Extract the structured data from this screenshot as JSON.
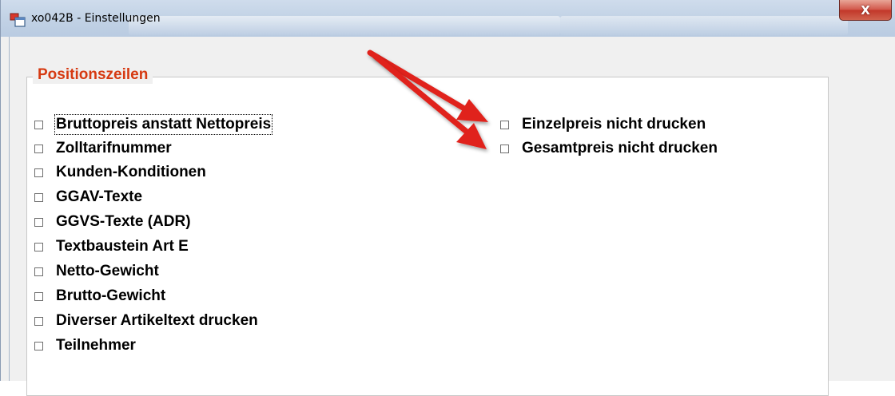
{
  "window": {
    "title": "xo042B - Einstellungen",
    "close_glyph": "X"
  },
  "group": {
    "legend": "Positionszeilen"
  },
  "left_options": [
    {
      "label": "Bruttopreis anstatt Nettopreis",
      "checked": false,
      "focused": true
    },
    {
      "label": "Zolltarifnummer",
      "checked": false
    },
    {
      "label": "Kunden-Konditionen",
      "checked": false
    },
    {
      "label": "GGAV-Texte",
      "checked": false
    },
    {
      "label": "GGVS-Texte (ADR)",
      "checked": false
    },
    {
      "label": "Textbaustein Art E",
      "checked": false
    },
    {
      "label": "Netto-Gewicht",
      "checked": false
    },
    {
      "label": "Brutto-Gewicht",
      "checked": false
    },
    {
      "label": "Diverser Artikeltext drucken",
      "checked": false
    },
    {
      "label": "Teilnehmer",
      "checked": false
    }
  ],
  "right_options": [
    {
      "label": "Einzelpreis nicht drucken",
      "checked": false
    },
    {
      "label": "Gesamtpreis nicht drucken",
      "checked": false
    }
  ],
  "colors": {
    "legend": "#d63a12",
    "annotation_arrow": "#e0201a"
  },
  "icons": {
    "app": "window-app-icon",
    "close": "close-icon",
    "annotation": "red-arrow-annotation"
  }
}
